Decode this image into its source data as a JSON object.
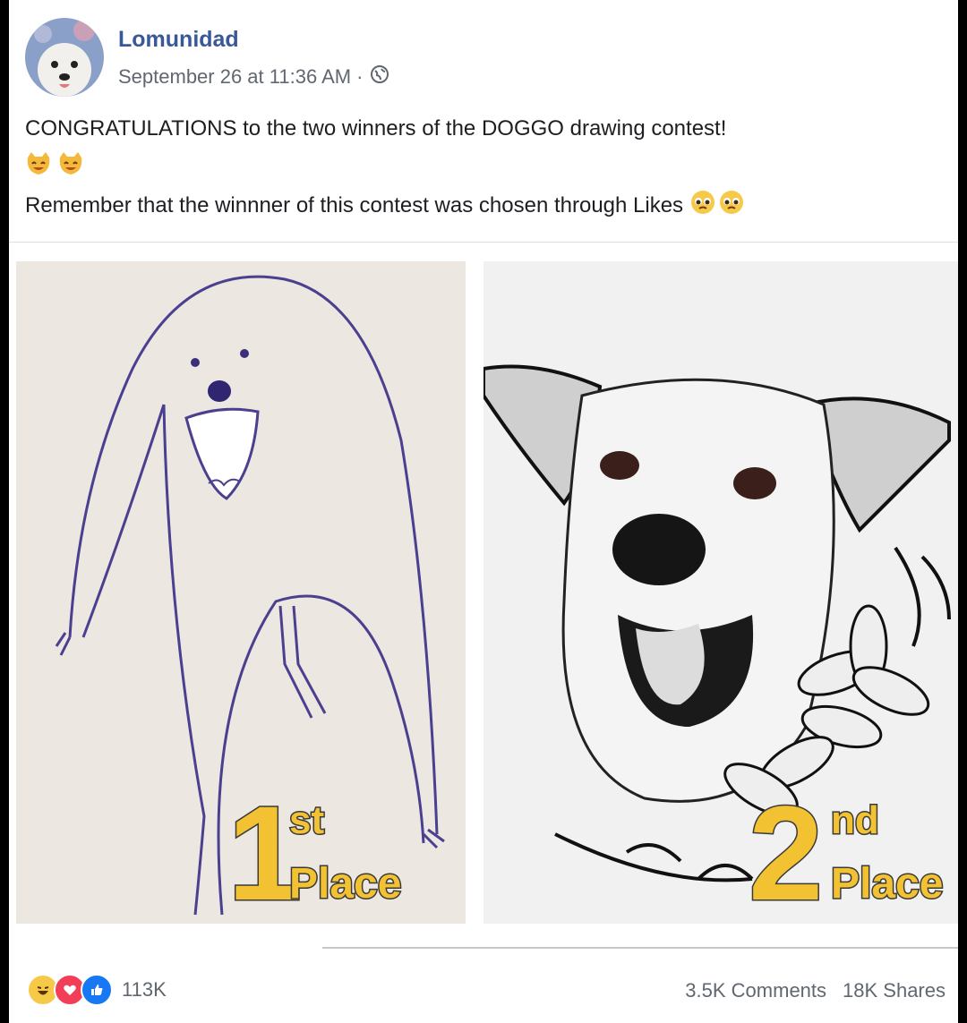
{
  "post": {
    "author": "Lomunidad",
    "timestamp": "September 26 at 11:36 AM",
    "separator": "·",
    "privacy_icon": "globe-icon",
    "text_line1": "CONGRATULATIONS to the two winners of the DOGGO drawing contest!",
    "text_line2": "Remember that the winnner of this contest was chosen through Likes"
  },
  "images": {
    "first": {
      "number": "1",
      "suffix": "st",
      "place": "Place"
    },
    "second": {
      "number": "2",
      "suffix": "nd",
      "place": "Place"
    }
  },
  "footer": {
    "reaction_icons": [
      "haha-icon",
      "love-icon",
      "like-icon"
    ],
    "reaction_count": "113K",
    "comments": "3.5K Comments",
    "shares": "18K Shares"
  },
  "colors": {
    "author": "#385898",
    "place_label": "#f2c232",
    "like": "#1877f2",
    "love": "#f33e58",
    "haha": "#f7c948"
  }
}
